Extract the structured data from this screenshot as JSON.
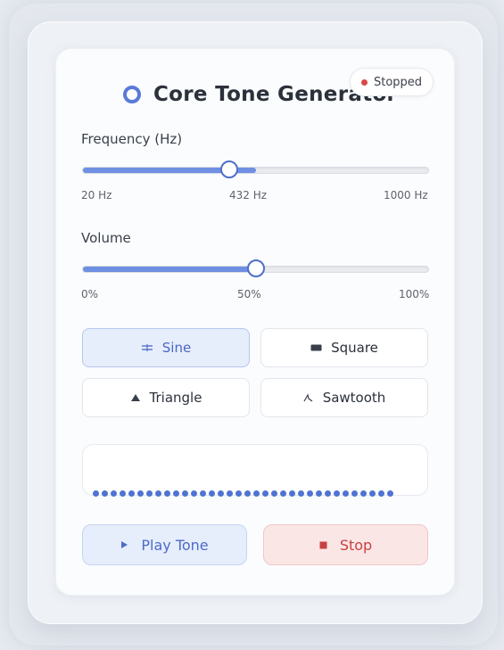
{
  "app": {
    "title": "Core Tone Generator"
  },
  "status": {
    "text": "Stopped",
    "color": "#d94646"
  },
  "frequency": {
    "label": "Frequency (Hz)",
    "min_label": "20 Hz",
    "current_label": "432 Hz",
    "max_label": "1000 Hz",
    "value": 432,
    "min": 20,
    "max": 1000
  },
  "volume": {
    "label": "Volume",
    "min_label": "0%",
    "current_label": "50%",
    "max_label": "100%",
    "value": 50,
    "min": 0,
    "max": 100
  },
  "waveforms": [
    {
      "label": "Sine",
      "icon": "sine-wave-icon",
      "selected": true
    },
    {
      "label": "Square",
      "icon": "square-wave-icon",
      "selected": false
    },
    {
      "label": "Triangle",
      "icon": "triangle-wave-icon",
      "selected": false
    },
    {
      "label": "Sawtooth",
      "icon": "sawtooth-wave-icon",
      "selected": false
    }
  ],
  "controls": {
    "play_label": "Play Tone",
    "stop_label": "Stop"
  },
  "colors": {
    "accent": "#5a7ad8",
    "stop": "#c94040"
  }
}
